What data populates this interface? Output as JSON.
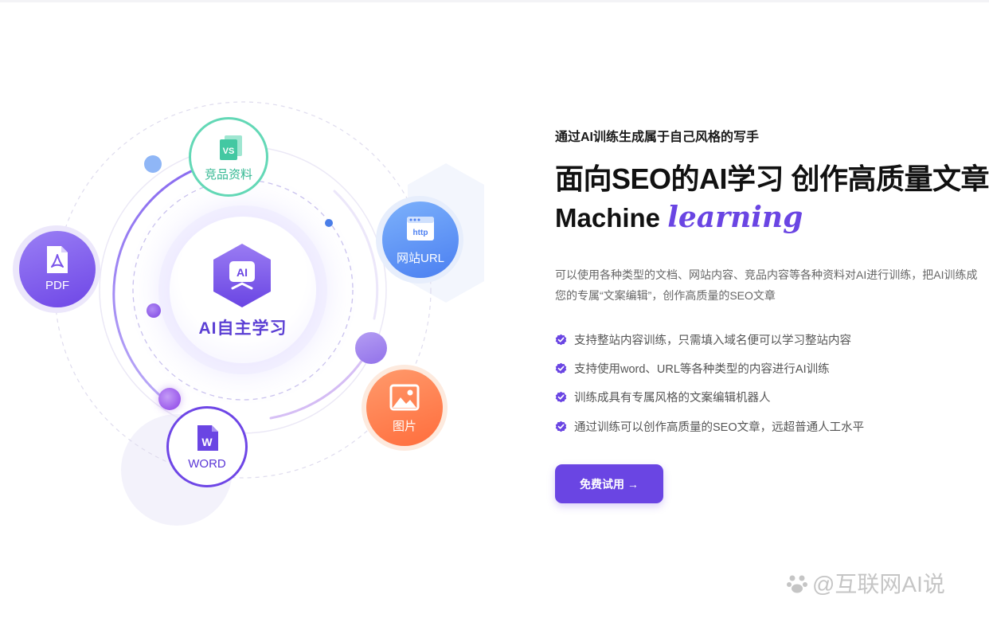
{
  "illustration": {
    "center_label": "AI自主学习",
    "center_icon_text": "AI",
    "nodes": {
      "competitor": {
        "icon_text": "VS",
        "label": "竞品资料"
      },
      "pdf": {
        "label": "PDF"
      },
      "url": {
        "icon_text": "http",
        "label": "网站URL"
      },
      "word": {
        "icon_text": "W",
        "label": "WORD"
      },
      "image": {
        "label": "图片"
      }
    },
    "colors": {
      "purple": "#6a45e3",
      "green": "#63d8b6",
      "blue": "#4b7ff1",
      "orange": "#ff6d3c"
    }
  },
  "content": {
    "kicker": "通过AI训练生成属于自己风格的写手",
    "headline": "面向SEO的AI学习 创作高质量文章",
    "subhead_plain": "Machine ",
    "subhead_accent": "learning",
    "description": "可以使用各种类型的文档、网站内容、竞品内容等各种资料对AI进行训练，把AI训练成您的专属“文案编辑”，创作高质量的SEO文章",
    "features": [
      "支持整站内容训练，只需填入域名便可以学习整站内容",
      "支持使用word、URL等各种类型的内容进行AI训练",
      "训练成具有专属风格的文案编辑机器人",
      "通过训练可以创作高质量的SEO文章，远超普通人工水平"
    ],
    "cta_label": "免费试用 →"
  },
  "watermark": {
    "text": "@互联网AI说"
  }
}
